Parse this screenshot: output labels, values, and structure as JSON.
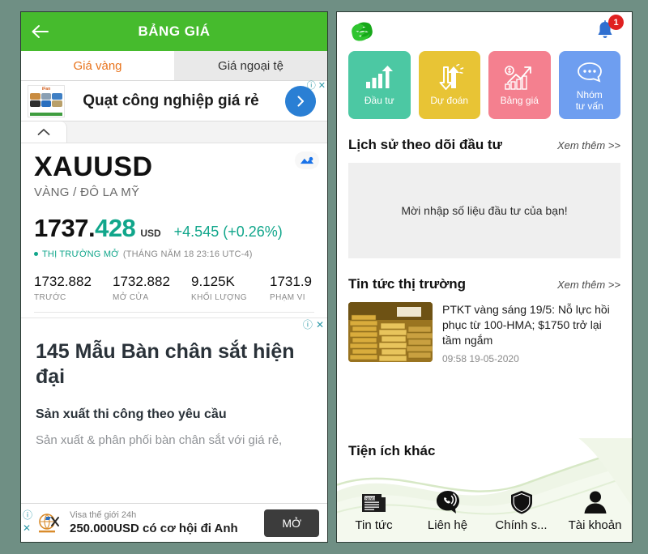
{
  "background_color": "#6f8f84",
  "left_panel": {
    "appbar": {
      "title": "BẢNG GIÁ",
      "back_icon": "arrow-left-icon",
      "color": "#46bb2d"
    },
    "tabs": [
      {
        "label": "Giá vàng",
        "active": true
      },
      {
        "label": "Giá ngoại tệ",
        "active": false
      }
    ],
    "top_ad": {
      "brand": "iFan",
      "headline": "Quạt công nghiệp giá rẻ",
      "cta_icon": "chevron-right-icon",
      "info_icon": "info-icon",
      "close_icon": "close-icon"
    },
    "collapse_icon": "chevron-up-icon",
    "quote": {
      "symbol": "XAUUSD",
      "description": "VÀNG / ĐÔ LA MỸ",
      "price_integer": "1737.",
      "price_decimal": "428",
      "currency": "USD",
      "change": "+4.545 (+0.26%)",
      "change_color": "#11a68b",
      "market_status": "THỊ TRƯỜNG MỞ",
      "market_time": "(THÁNG NĂM 18 23:16 UTC-4)",
      "chart_badge_icon": "mountain-chart-icon",
      "stats": [
        {
          "value": "1732.882",
          "label": "TRƯỚC"
        },
        {
          "value": "1732.882",
          "label": "MỞ CỬA"
        },
        {
          "value": "9.125K",
          "label": "KHỐI LƯỢNG"
        },
        {
          "value": "1731.9",
          "label": "PHẠM VI"
        }
      ]
    },
    "big_ad": {
      "title": "145 Mẫu Bàn chân sắt hiện đại",
      "subtitle": "Sản xuất thi công theo yêu cầu",
      "body": "Sản xuất & phân phối bàn chân sắt với giá rẻ,",
      "info_icon": "info-icon",
      "close_icon": "close-icon"
    },
    "bottom_ad": {
      "line1": "Visa thế giới 24h",
      "line2": "250.000USD có cơ hội đi Anh",
      "button": "MỞ",
      "info_icon": "info-icon",
      "close_icon": "close-icon"
    }
  },
  "right_panel": {
    "header": {
      "logo_icon": "app-logo-icon",
      "bell_icon": "bell-icon",
      "notification_count": "1",
      "badge_color": "#e02020"
    },
    "tiles": [
      {
        "label": "Đầu tư",
        "color": "#4cc8a3",
        "icon": "bar-chart-up-icon"
      },
      {
        "label": "Dự đoán",
        "color": "#e8c435",
        "icon": "arrow-down-up-icon"
      },
      {
        "label": "Bảng giá",
        "color": "#f4808f",
        "icon": "price-chart-icon"
      },
      {
        "label": "Nhóm\ntư vấn",
        "color": "#6e9ef0",
        "icon": "chat-bubble-icon"
      }
    ],
    "history_section": {
      "title": "Lịch sử theo dõi đầu tư",
      "more": "Xem thêm >>",
      "empty_message": "Mời nhập số liệu đầu tư của bạn!"
    },
    "news_section": {
      "title": "Tin tức thị trường",
      "more": "Xem thêm >>",
      "items": [
        {
          "thumb": "gold-bars-image",
          "title": "PTKT vàng sáng 19/5: Nỗ lực hồi phục từ 100-HMA; $1750 trở lại tầm ngắm",
          "time": "09:58 19-05-2020"
        }
      ]
    },
    "utilities_section": {
      "title": "Tiện ích khác",
      "items": [
        {
          "label": "Tin tức",
          "icon": "newspaper-icon"
        },
        {
          "label": "Liên hệ",
          "icon": "phone-chat-icon"
        },
        {
          "label": "Chính s...",
          "icon": "shield-icon"
        },
        {
          "label": "Tài khoản",
          "icon": "user-icon"
        }
      ]
    }
  }
}
